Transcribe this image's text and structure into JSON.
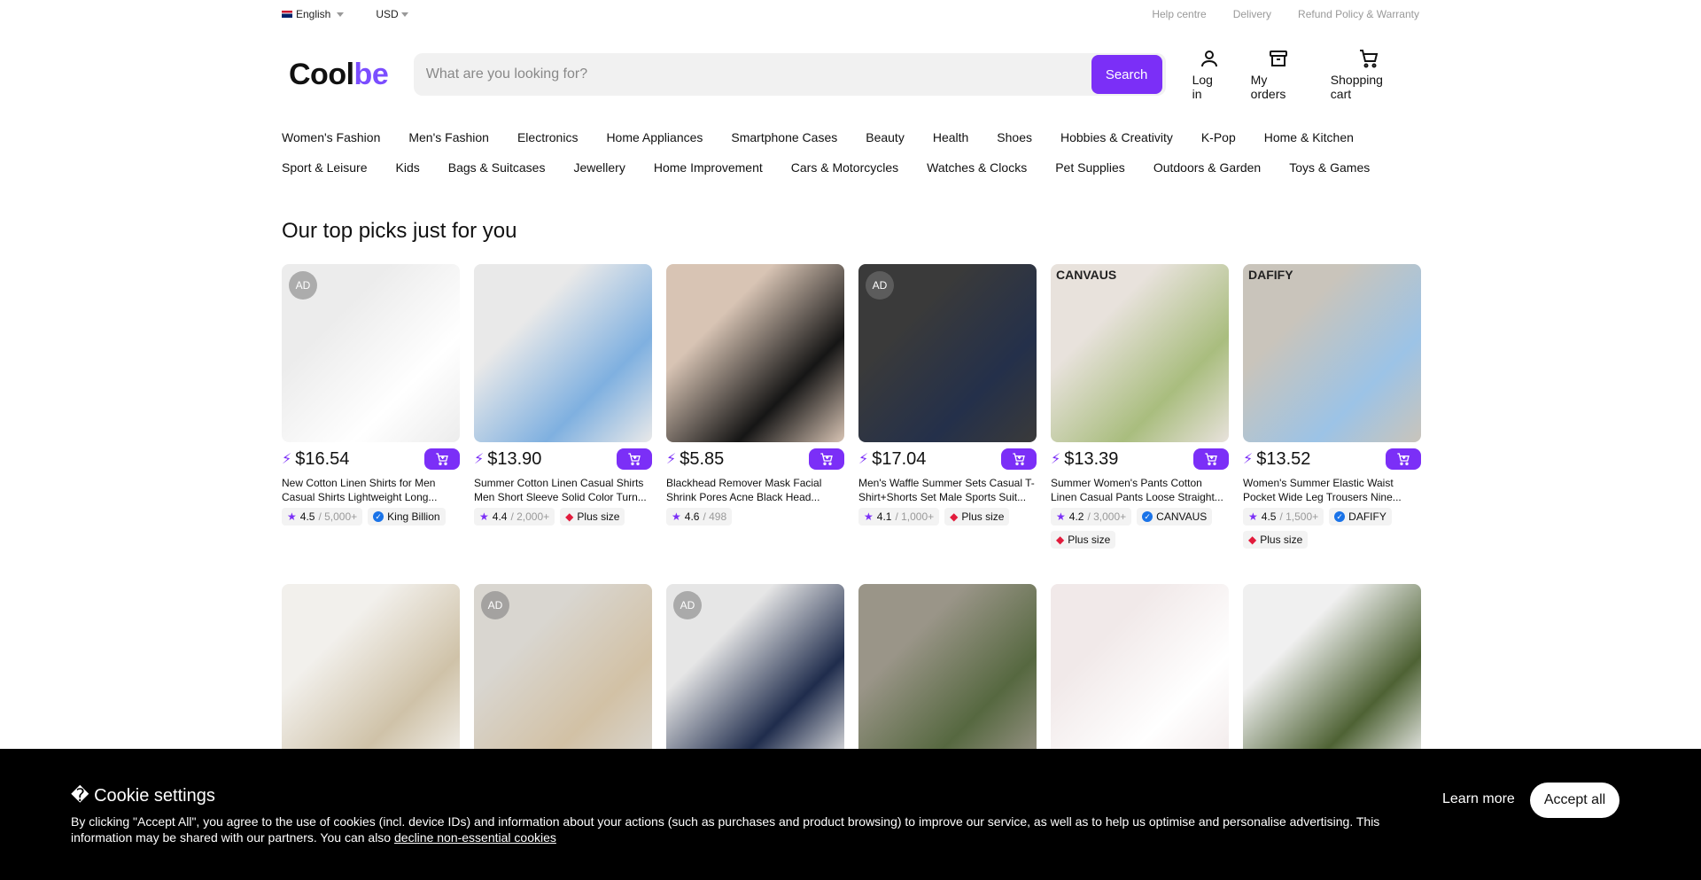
{
  "topbar": {
    "language": "English",
    "currency": "USD",
    "links": [
      "Help centre",
      "Delivery",
      "Refund Policy & Warranty"
    ]
  },
  "header": {
    "logo_main": "Cool",
    "logo_accent": "be",
    "search_placeholder": "What are you looking for?",
    "search_button": "Search",
    "login": "Log in",
    "orders": "My orders",
    "cart": "Shopping cart"
  },
  "categories": {
    "row1": [
      "Women's Fashion",
      "Men's Fashion",
      "Electronics",
      "Home Appliances",
      "Smartphone Cases",
      "Beauty",
      "Health",
      "Shoes",
      "Hobbies & Creativity",
      "K-Pop",
      "Home & Kitchen"
    ],
    "row2": [
      "Sport & Leisure",
      "Kids",
      "Bags & Suitcases",
      "Jewellery",
      "Home Improvement",
      "Cars & Motorcycles",
      "Watches & Clocks",
      "Pet Supplies",
      "Outdoors & Garden",
      "Toys & Games"
    ]
  },
  "section_title": "Our top picks just for you",
  "products": [
    {
      "ad": "AD",
      "brand_overlay": "",
      "price": "$16.54",
      "name": "New Cotton Linen Shirts for Men Casual Shirts Lightweight Long...",
      "rating": "4.5",
      "count": "/ 5,000+",
      "seller": "King Billion",
      "plus": "",
      "colors": [
        "#ececec",
        "#ffffff"
      ]
    },
    {
      "ad": "",
      "brand_overlay": "",
      "price": "$13.90",
      "name": "Summer Cotton Linen Casual Shirts Men Short Sleeve Solid Color Turn...",
      "rating": "4.4",
      "count": "/ 2,000+",
      "seller": "",
      "plus": "Plus size",
      "colors": [
        "#e9e9e9",
        "#7fb0e0"
      ]
    },
    {
      "ad": "",
      "brand_overlay": "",
      "price": "$5.85",
      "name": "Blackhead Remover Mask Facial Shrink Pores Acne Black Head...",
      "rating": "4.6",
      "count": "/ 498",
      "seller": "",
      "plus": "",
      "colors": [
        "#d8c4b4",
        "#151515"
      ]
    },
    {
      "ad": "AD",
      "brand_overlay": "",
      "price": "$17.04",
      "name": "Men's Waffle Summer Sets Casual T-Shirt+Shorts Set Male Sports Suit...",
      "rating": "4.1",
      "count": "/ 1,000+",
      "seller": "",
      "plus": "Plus size",
      "colors": [
        "#3a3a3a",
        "#24304a"
      ]
    },
    {
      "ad": "",
      "brand_overlay": "CANVAUS",
      "price": "$13.39",
      "name": "Summer Women's Pants Cotton Linen Casual Pants Loose Straight...",
      "rating": "4.2",
      "count": "/ 3,000+",
      "seller": "CANVAUS",
      "plus": "Plus size",
      "colors": [
        "#e8e2dc",
        "#a9bd7e"
      ]
    },
    {
      "ad": "",
      "brand_overlay": "DAFIFY",
      "price": "$13.52",
      "name": "Women's Summer Elastic Waist Pocket Wide Leg Trousers Nine...",
      "rating": "4.5",
      "count": "/ 1,500+",
      "seller": "DAFIFY",
      "plus": "Plus size",
      "colors": [
        "#c9c4bb",
        "#9cc3e6"
      ]
    },
    {
      "ad": "",
      "brand_overlay": "",
      "colors": [
        "#f2f0ec",
        "#cfc2a8"
      ]
    },
    {
      "ad": "AD",
      "brand_overlay": "",
      "colors": [
        "#d9d6d0",
        "#d2c1a5"
      ]
    },
    {
      "ad": "AD",
      "brand_overlay": "",
      "colors": [
        "#e6e6e6",
        "#1f2c4c"
      ]
    },
    {
      "ad": "",
      "brand_overlay": "",
      "colors": [
        "#9a9588",
        "#566840"
      ]
    },
    {
      "ad": "",
      "brand_overlay": "",
      "colors": [
        "#f1e9e9",
        "#ffffff"
      ]
    },
    {
      "ad": "",
      "brand_overlay": "",
      "colors": [
        "#f0f0f0",
        "#4e6234"
      ]
    }
  ],
  "cookie": {
    "title": "Cookie settings",
    "text": "By clicking \"Accept All\", you agree to the use of cookies (incl. device IDs) and information about your actions (such as purchases and product browsing) to improve our service, as well as to help us optimise and personalise advertising. This information may be shared with our partners. You can also",
    "decline_link": "decline non-essential cookies",
    "learn_more": "Learn more",
    "accept_all": "Accept all"
  },
  "colors": {
    "accent": "#7b2ff7",
    "logo_accent": "#7b4dff"
  }
}
